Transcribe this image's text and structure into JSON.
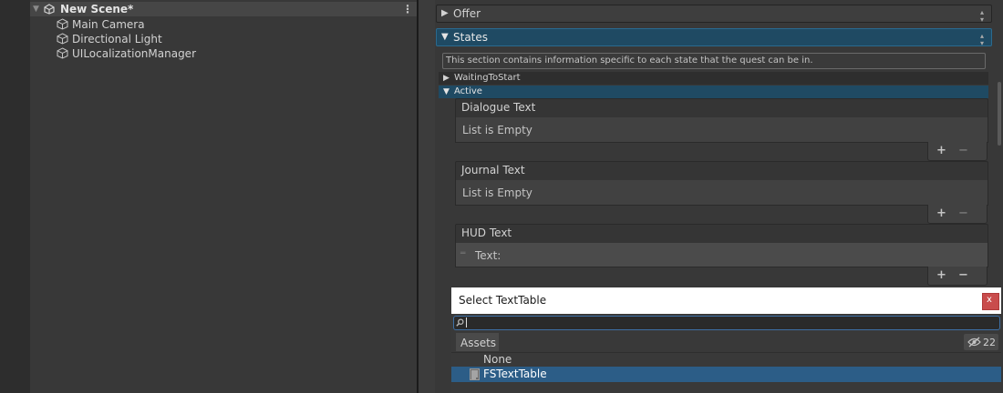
{
  "hierarchy": {
    "scene_name": "New Scene*",
    "objects": [
      "Main Camera",
      "Directional Light",
      "UILocalizationManager"
    ]
  },
  "inspector": {
    "offer_label": "Offer",
    "states_label": "States",
    "help_text": "This section contains information specific to each state that the quest can be in.",
    "state_waiting": "WaitingToStart",
    "state_active": "Active",
    "lists": [
      {
        "title": "Dialogue Text",
        "body": "List is Empty"
      },
      {
        "title": "Journal Text",
        "body": "List is Empty"
      },
      {
        "title": "HUD Text",
        "body": "Text:"
      }
    ],
    "plus_glyph": "+",
    "minus_glyph": "−"
  },
  "popup": {
    "title": "Select TextTable",
    "close_glyph": "x",
    "search_value": "",
    "tab_label": "Assets",
    "hidden_count": "22",
    "items": [
      "None",
      "FSTextTable"
    ],
    "selected_item": "FSTextTable"
  },
  "colors": {
    "states_header": "#1f4a63",
    "active_row": "#1f4a63",
    "selected_row": "#2c5d87",
    "close_button": "#c94c4c"
  }
}
